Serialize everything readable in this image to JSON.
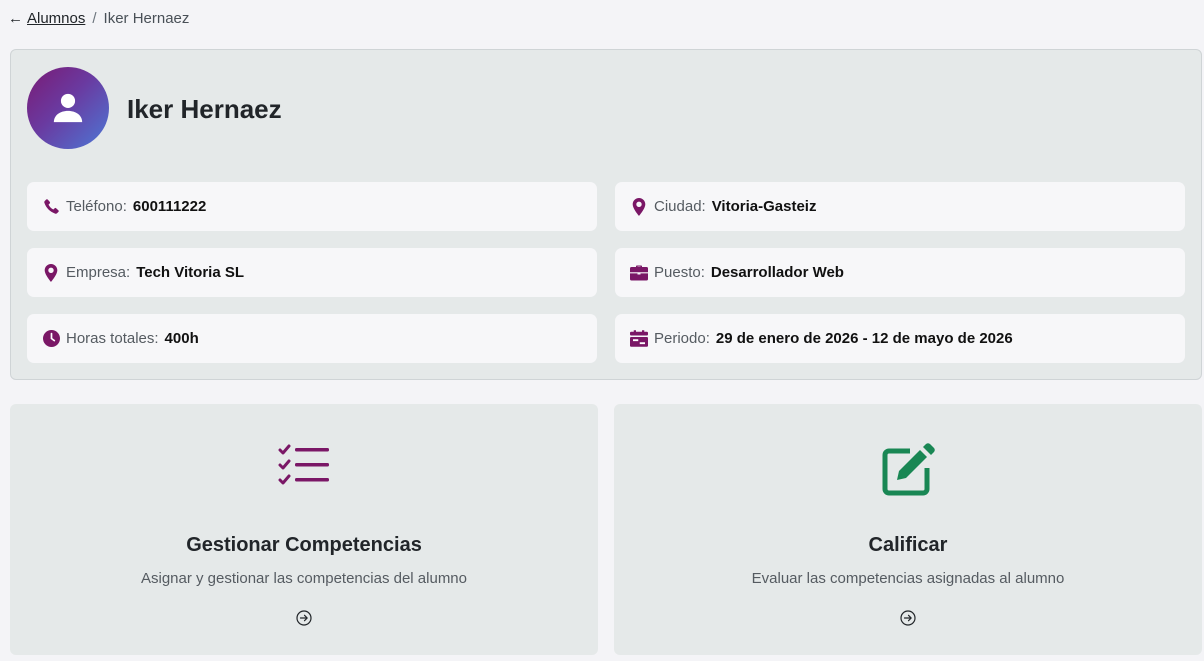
{
  "breadcrumb": {
    "arrow": "←",
    "parent": "Alumnos",
    "separator": "/",
    "current": "Iker Hernaez"
  },
  "profile": {
    "name": "Iker Hernaez",
    "avatar_icon": "user-icon",
    "info": {
      "telefono": {
        "icon": "phone-icon",
        "label": "Teléfono:",
        "value": "600111222"
      },
      "ciudad": {
        "icon": "map-marker-icon",
        "label": "Ciudad:",
        "value": "Vitoria-Gasteiz"
      },
      "empresa": {
        "icon": "map-marker-icon",
        "label": "Empresa:",
        "value": "Tech Vitoria SL"
      },
      "puesto": {
        "icon": "briefcase-icon",
        "label": "Puesto:",
        "value": "Desarrollador Web"
      },
      "horas": {
        "icon": "clock-icon",
        "label": "Horas totales:",
        "value": "400h"
      },
      "periodo": {
        "icon": "calendar-icon",
        "label": "Periodo:",
        "value": "29 de enero de 2026 - 12 de mayo de 2026"
      }
    }
  },
  "actions": {
    "competencias": {
      "icon": "checklist-icon",
      "title": "Gestionar Competencias",
      "description": "Asignar y gestionar las competencias del alumno",
      "go_icon": "arrow-circle-right-icon"
    },
    "calificar": {
      "icon": "edit-icon",
      "title": "Calificar",
      "description": "Evaluar las competencias asignadas al alumno",
      "go_icon": "arrow-circle-right-icon"
    }
  },
  "colors": {
    "accent": "#7a1766",
    "success": "#198754",
    "card_bg": "#e5e9e9",
    "page_bg": "#f4f4f7"
  }
}
